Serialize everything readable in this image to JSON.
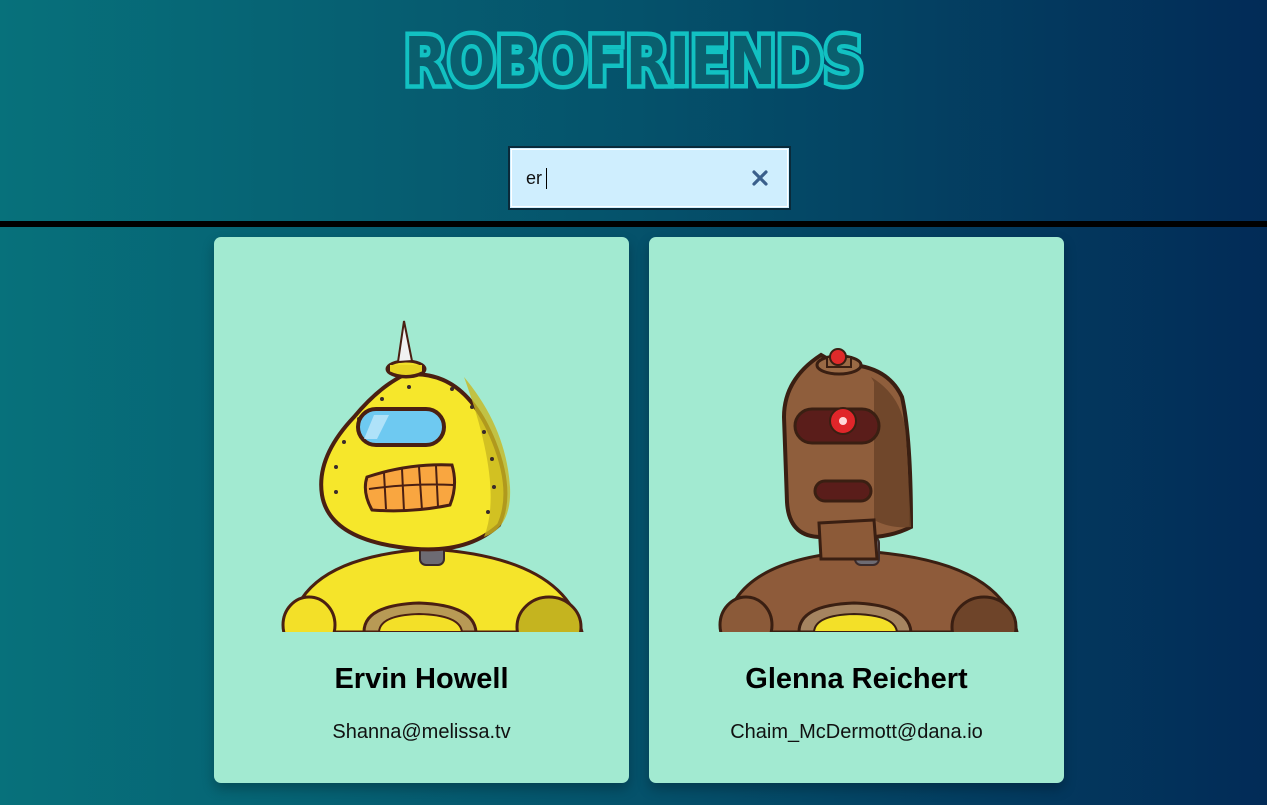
{
  "header": {
    "title": "ROBOFRIENDS"
  },
  "search": {
    "value": "er",
    "clear_icon": "close-icon"
  },
  "robots": [
    {
      "name": "Ervin Howell",
      "email": "Shanna@melissa.tv",
      "avatar_icon": "yellow-robot-avatar"
    },
    {
      "name": "Glenna Reichert",
      "email": "Chaim_McDermott@dana.io",
      "avatar_icon": "brown-robot-avatar"
    }
  ],
  "colors": {
    "title": "#12c1c2",
    "card_background": "#a2ead1",
    "search_background": "#cfeefe"
  }
}
